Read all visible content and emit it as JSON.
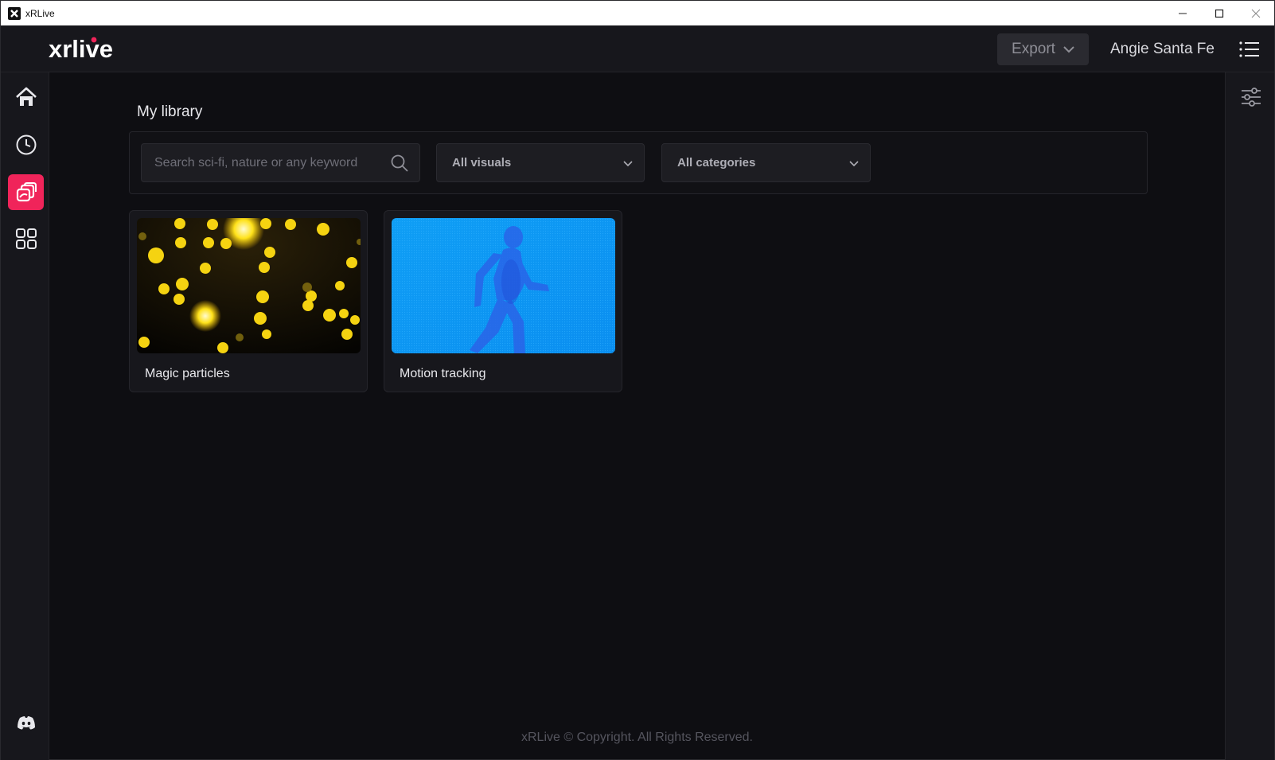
{
  "window": {
    "title": "xRLive"
  },
  "topbar": {
    "logo_text": "xrlive",
    "export_label": "Export",
    "username": "Angie Santa Fe"
  },
  "sidebar": {
    "items": [
      {
        "name": "home",
        "icon": "home-icon",
        "active": false
      },
      {
        "name": "history",
        "icon": "clock-icon",
        "active": false
      },
      {
        "name": "library",
        "icon": "library-icon",
        "active": true
      },
      {
        "name": "apps",
        "icon": "grid-icon",
        "active": false
      }
    ],
    "bottom_icon": "discord-icon"
  },
  "main": {
    "title": "My library",
    "search": {
      "placeholder": "Search sci-fi, nature or any keyword",
      "value": ""
    },
    "visuals_select": "All visuals",
    "categories_select": "All categories",
    "cards": [
      {
        "label": "Magic particles"
      },
      {
        "label": "Motion tracking"
      }
    ],
    "footer": "xRLive © Copyright. All Rights Reserved."
  },
  "colors": {
    "accent": "#f0245a",
    "background": "#0e0e12",
    "panel": "#17171c"
  }
}
